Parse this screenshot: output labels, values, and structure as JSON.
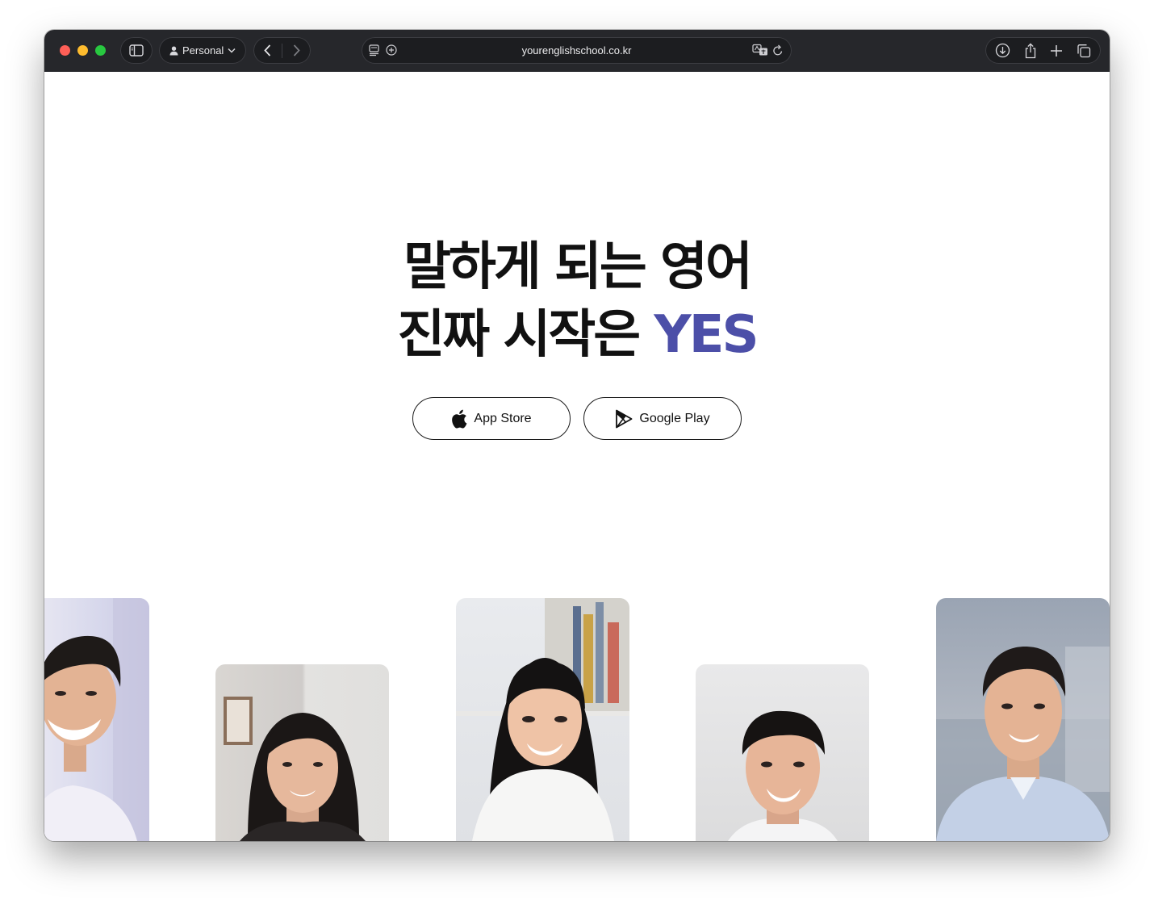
{
  "browser": {
    "profile_label": "Personal",
    "url": "yourenglishschool.co.kr"
  },
  "hero": {
    "line1": "말하게 되는 영어",
    "line2_prefix": "진짜 시작은 ",
    "line2_accent": "YES",
    "accent_color": "#4c4fa8"
  },
  "buttons": {
    "app_store": "App Store",
    "google_play": "Google Play"
  },
  "icons": {
    "sidebar": "sidebar-icon",
    "profile": "person-icon",
    "back": "chevron-left-icon",
    "forward": "chevron-right-icon",
    "reader": "reader-icon",
    "add_tab_group": "plus-circle-icon",
    "translate": "translate-icon",
    "reload": "reload-icon",
    "download": "download-icon",
    "share": "share-icon",
    "new_tab": "plus-icon",
    "tab_overview": "tabs-icon",
    "apple": "apple-icon",
    "google_play": "google-play-icon"
  },
  "gallery": {
    "photos": [
      "person-photo",
      "person-photo",
      "person-photo",
      "person-photo",
      "person-photo"
    ]
  }
}
